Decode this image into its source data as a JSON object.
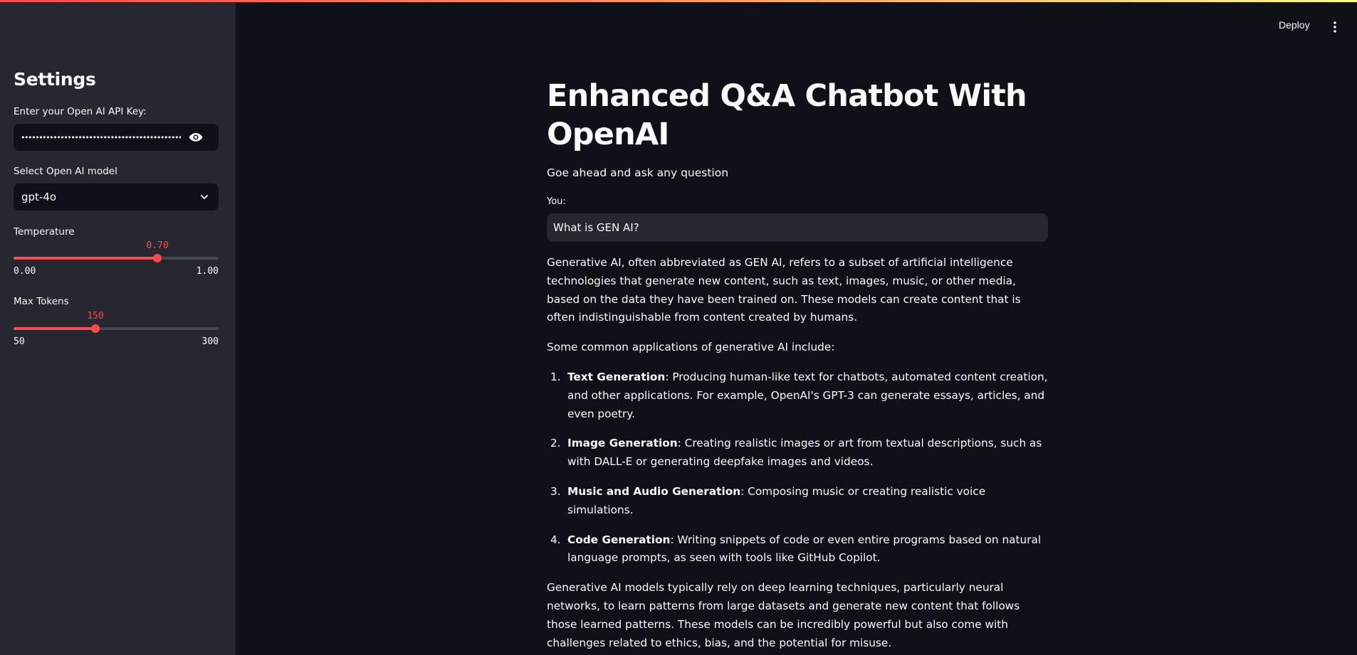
{
  "sidebar": {
    "title": "Settings",
    "api_key_label": "Enter your Open AI API Key:",
    "api_key_value": "••••••••••••••••••••••••••••••••••••••••••••••",
    "model_label": "Select Open AI model",
    "model_value": "gpt-4o",
    "temperature": {
      "label": "Temperature",
      "value": "0.70",
      "min": "0.00",
      "max": "1.00",
      "fraction": 0.7
    },
    "max_tokens": {
      "label": "Max Tokens",
      "value": "150",
      "min": "50",
      "max": "300",
      "fraction": 0.4
    }
  },
  "header": {
    "deploy_label": "Deploy"
  },
  "main": {
    "title": "Enhanced Q&A Chatbot With OpenAI",
    "subtitle": "Goe ahead and ask any question",
    "you_label": "You:",
    "question": "What is GEN AI?",
    "answer": {
      "intro": "Generative AI, often abbreviated as GEN AI, refers to a subset of artificial intelligence technologies that generate new content, such as text, images, music, or other media, based on the data they have been trained on. These models can create content that is often indistinguishable from content created by humans.",
      "list_intro": "Some common applications of generative AI include:",
      "items": [
        {
          "num": "1.",
          "bold": "Text Generation",
          "text": ": Producing human-like text for chatbots, automated content creation, and other applications. For example, OpenAI's GPT-3 can generate essays, articles, and even poetry."
        },
        {
          "num": "2.",
          "bold": "Image Generation",
          "text": ": Creating realistic images or art from textual descriptions, such as with DALL-E or generating deepfake images and videos."
        },
        {
          "num": "3.",
          "bold": "Music and Audio Generation",
          "text": ": Composing music or creating realistic voice simulations."
        },
        {
          "num": "4.",
          "bold": "Code Generation",
          "text": ": Writing snippets of code or even entire programs based on natural language prompts, as seen with tools like GitHub Copilot."
        }
      ],
      "outro": "Generative AI models typically rely on deep learning techniques, particularly neural networks, to learn patterns from large datasets and generate new content that follows those learned patterns. These models can be incredibly powerful but also come with challenges related to ethics, bias, and the potential for misuse."
    }
  },
  "colors": {
    "accent": "#ff4b4b",
    "background": "#0e1117",
    "sidebar": "#262730"
  },
  "icons": [
    "eye-icon",
    "chevron-down-icon",
    "kebab-menu-icon"
  ]
}
